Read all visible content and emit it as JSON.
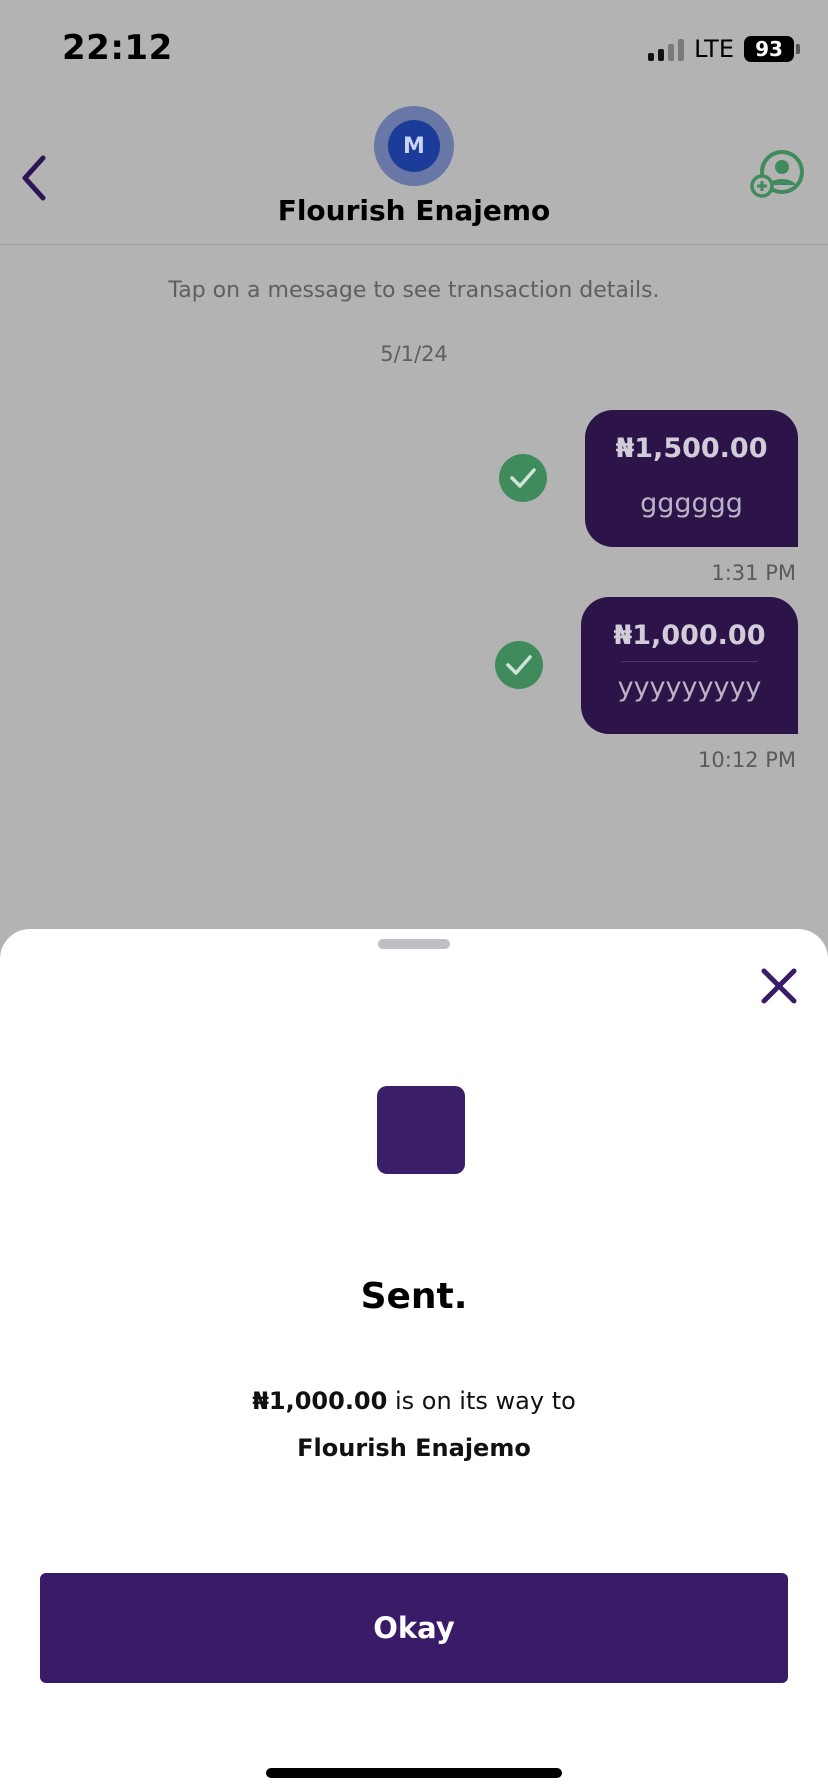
{
  "status_bar": {
    "time": "22:12",
    "network": "LTE",
    "battery": "93"
  },
  "header": {
    "avatar_initial": "M",
    "contact_name": "Flourish Enajemo"
  },
  "chat": {
    "hint": "Tap on a message to see transaction details.",
    "date": "5/1/24",
    "messages": [
      {
        "amount": "₦1,500.00",
        "note": "gggggg",
        "time": "1:31 PM"
      },
      {
        "amount": "₦1,000.00",
        "note": "yyyyyyyyy",
        "time": "10:12 PM"
      }
    ]
  },
  "sheet": {
    "title": "Sent.",
    "amount": "₦1,000.00",
    "message_middle": "is on its way to",
    "recipient": "Flourish Enajemo",
    "okay_label": "Okay"
  },
  "colors": {
    "accent": "#3a1b67",
    "bubble": "#2c1449",
    "success": "#3f8b5b",
    "overlay": "#b3b3b3"
  },
  "icons": [
    "back-chevron-icon",
    "add-contact-icon",
    "check-icon",
    "close-icon"
  ]
}
